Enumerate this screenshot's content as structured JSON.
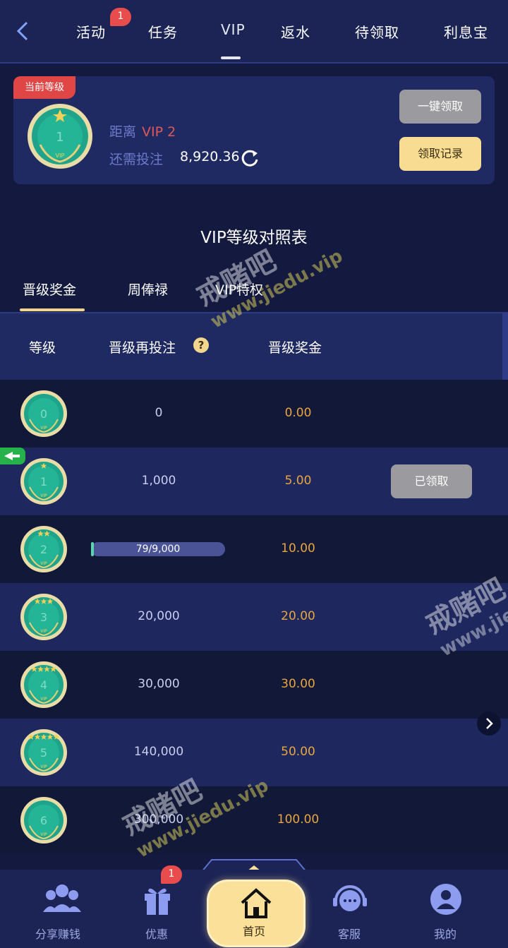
{
  "topnav": {
    "tabs": [
      "活动",
      "任务",
      "VIP",
      "返水",
      "待领取",
      "利息宝"
    ],
    "activity_badge": "1"
  },
  "status_card": {
    "tag": "当前等级",
    "current_level": "1",
    "distance_label": "距离",
    "next_vip": "VIP 2",
    "need_label": "还需投注",
    "need_amount": "8,920.36",
    "claim_all": "一键领取",
    "records": "领取记录"
  },
  "section_title": "VIP等级对照表",
  "subtabs": [
    "晋级奖金",
    "周俸禄",
    "VIP特权"
  ],
  "table": {
    "headers": [
      "等级",
      "晋级再投注",
      "晋级奖金"
    ],
    "rows": [
      {
        "level": "0",
        "requirement": "0",
        "bonus": "0.00",
        "stars": 0
      },
      {
        "level": "1",
        "requirement": "1,000",
        "bonus": "5.00",
        "stars": 1,
        "action": "已领取"
      },
      {
        "level": "2",
        "requirement": "79/9,000",
        "bonus": "10.00",
        "stars": 2,
        "progress": 0.0088
      },
      {
        "level": "3",
        "requirement": "20,000",
        "bonus": "20.00",
        "stars": 3
      },
      {
        "level": "4",
        "requirement": "30,000",
        "bonus": "30.00",
        "stars": 4
      },
      {
        "level": "5",
        "requirement": "140,000",
        "bonus": "50.00",
        "stars": 5
      },
      {
        "level": "6",
        "requirement": "300,000",
        "bonus": "100.00",
        "stars": 0
      }
    ]
  },
  "bottom_nav": {
    "items": [
      "分享赚钱",
      "优惠",
      "首页",
      "客服",
      "我的"
    ],
    "promo_badge": "1"
  },
  "colors": {
    "bg": "#141a3f",
    "card": "#1f2a63",
    "accent_gold": "#f8dc92",
    "bonus_orange": "#e9a53f",
    "badge_red": "#e84c4c",
    "medal_teal": "#1fa38a"
  },
  "watermark": {
    "text1": "www.jiedu.vip",
    "text2": "戒赌吧"
  }
}
